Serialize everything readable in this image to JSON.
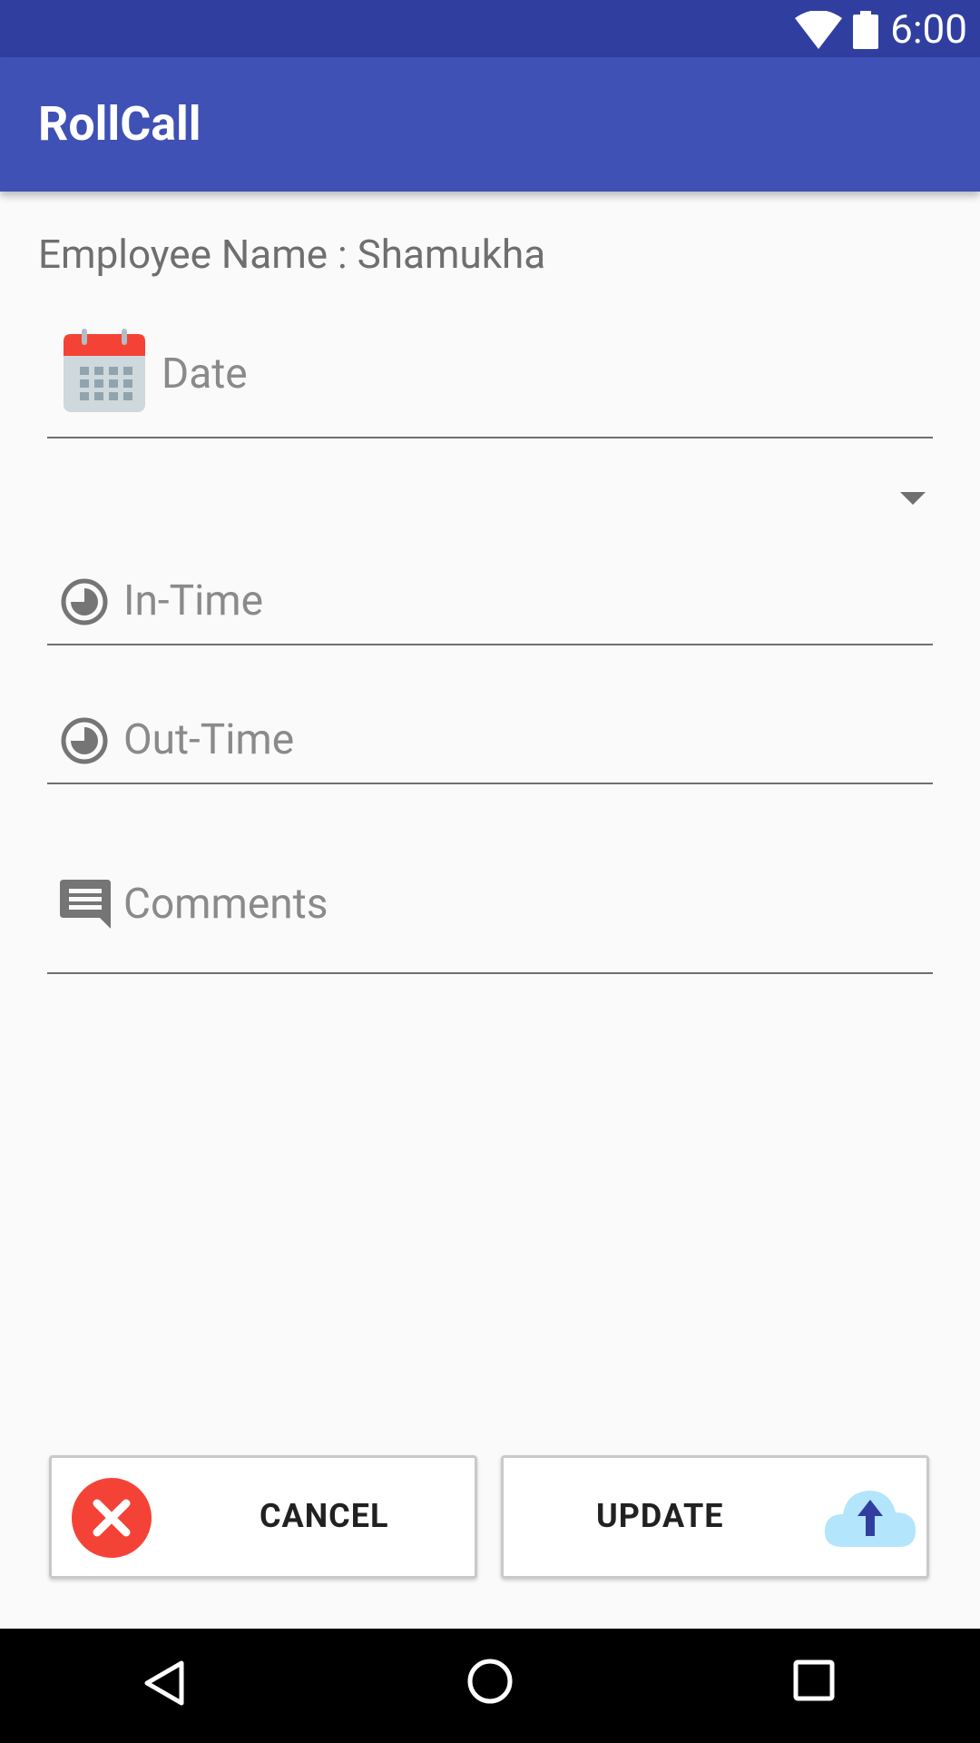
{
  "status_bar": {
    "time": "6:00"
  },
  "app_bar": {
    "title": "RollCall"
  },
  "form": {
    "employee_label": "Employee Name : Shamukha",
    "date_placeholder": "Date",
    "in_time_placeholder": "In-Time",
    "out_time_placeholder": "Out-Time",
    "comments_placeholder": "Comments"
  },
  "buttons": {
    "cancel_label": "CANCEL",
    "update_label": "UPDATE"
  },
  "colors": {
    "primary": "#3f51b5",
    "primary_dark": "#303f9f",
    "cancel_icon": "#f44336",
    "upload_icon": "#b3e5fc"
  },
  "icons": {
    "status": [
      "wifi-icon",
      "battery-icon"
    ],
    "fields": [
      "calendar-icon",
      "clock-icon",
      "clock-icon",
      "comment-icon"
    ],
    "buttons": [
      "close-circle-icon",
      "cloud-upload-icon"
    ],
    "nav": [
      "back-icon",
      "home-icon",
      "recents-icon"
    ]
  }
}
